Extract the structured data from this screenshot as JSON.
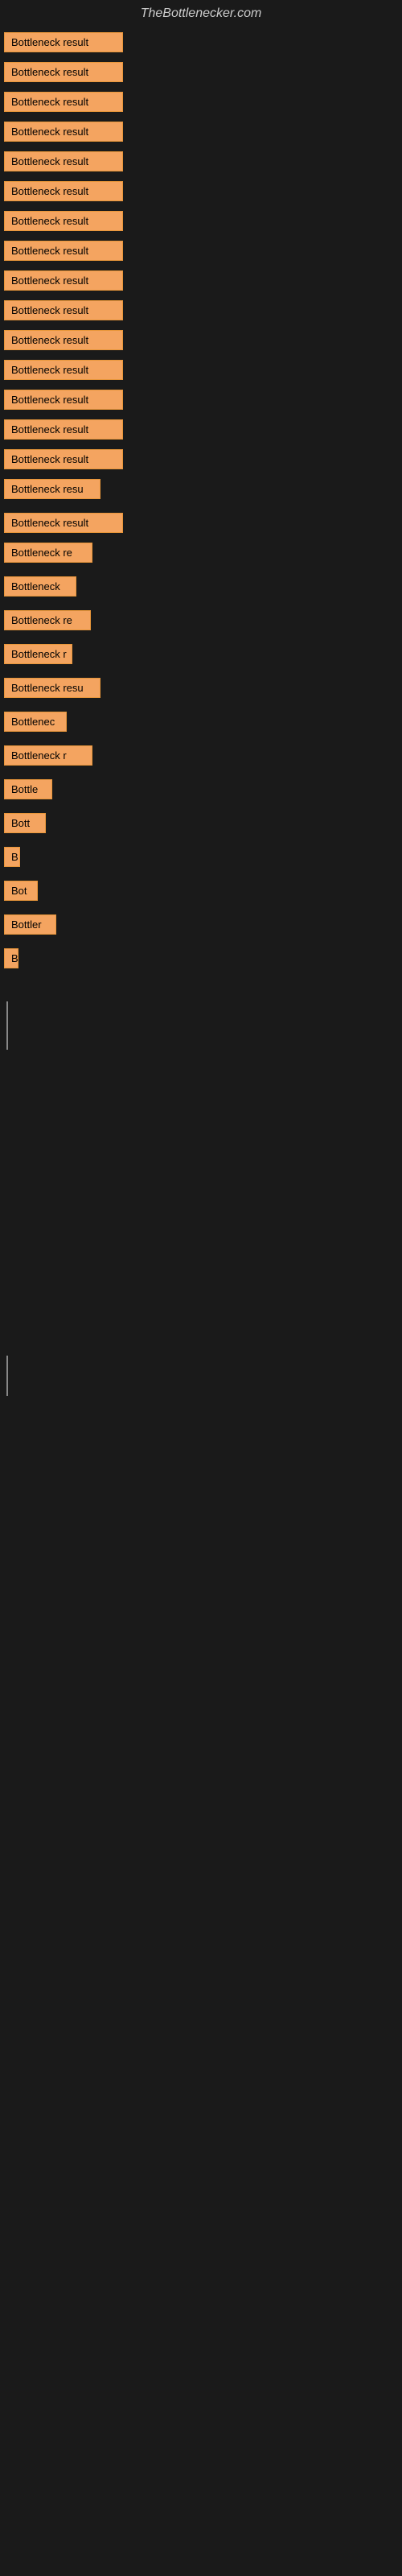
{
  "site": {
    "title": "TheBottlenecker.com"
  },
  "items": [
    {
      "id": 1,
      "label": "Bottleneck result"
    },
    {
      "id": 2,
      "label": "Bottleneck result"
    },
    {
      "id": 3,
      "label": "Bottleneck result"
    },
    {
      "id": 4,
      "label": "Bottleneck result"
    },
    {
      "id": 5,
      "label": "Bottleneck result"
    },
    {
      "id": 6,
      "label": "Bottleneck result"
    },
    {
      "id": 7,
      "label": "Bottleneck result"
    },
    {
      "id": 8,
      "label": "Bottleneck result"
    },
    {
      "id": 9,
      "label": "Bottleneck result"
    },
    {
      "id": 10,
      "label": "Bottleneck result"
    },
    {
      "id": 11,
      "label": "Bottleneck result"
    },
    {
      "id": 12,
      "label": "Bottleneck result"
    },
    {
      "id": 13,
      "label": "Bottleneck result"
    },
    {
      "id": 14,
      "label": "Bottleneck result"
    },
    {
      "id": 15,
      "label": "Bottleneck result"
    },
    {
      "id": 16,
      "label": "Bottleneck resu"
    },
    {
      "id": 17,
      "label": "Bottleneck result"
    },
    {
      "id": 18,
      "label": "Bottleneck re"
    },
    {
      "id": 19,
      "label": "Bottleneck"
    },
    {
      "id": 20,
      "label": "Bottleneck re"
    },
    {
      "id": 21,
      "label": "Bottleneck r"
    },
    {
      "id": 22,
      "label": "Bottleneck resu"
    },
    {
      "id": 23,
      "label": "Bottlenec"
    },
    {
      "id": 24,
      "label": "Bottleneck r"
    },
    {
      "id": 25,
      "label": "Bottle"
    },
    {
      "id": 26,
      "label": "Bott"
    },
    {
      "id": 27,
      "label": "B"
    },
    {
      "id": 28,
      "label": "Bot"
    },
    {
      "id": 29,
      "label": "Bottler"
    },
    {
      "id": 30,
      "label": "B"
    }
  ]
}
